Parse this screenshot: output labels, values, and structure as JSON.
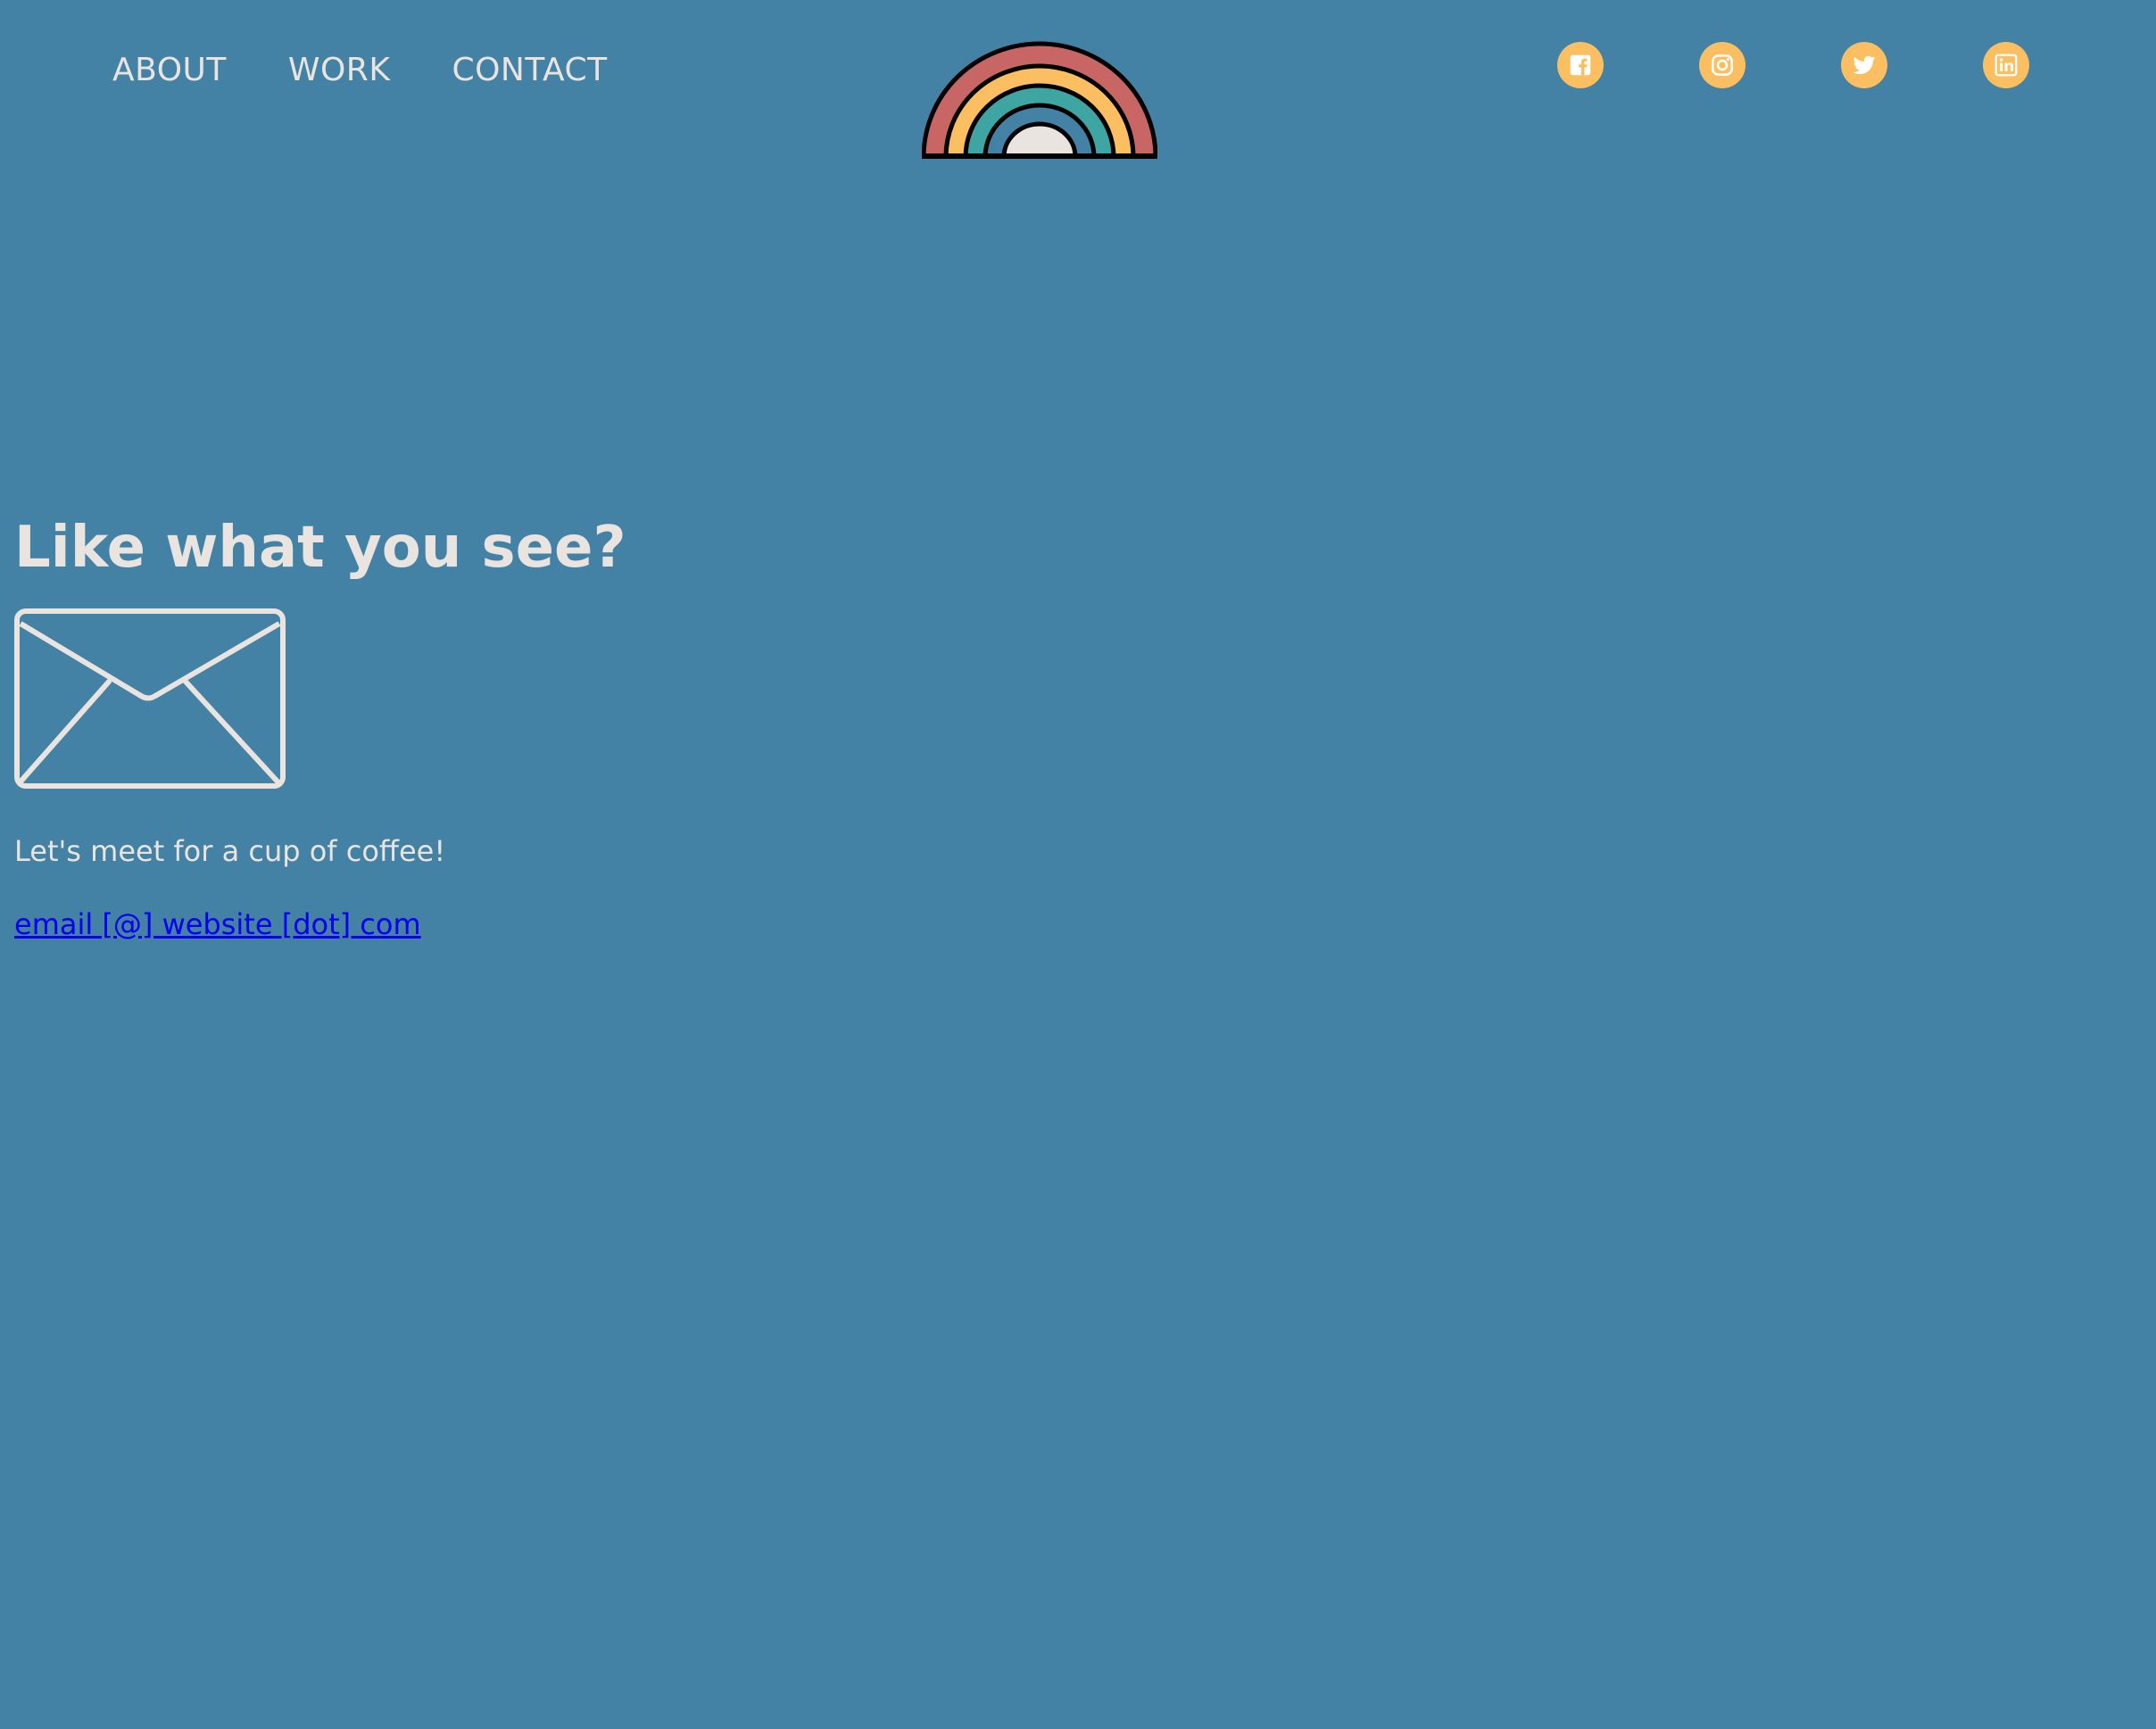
{
  "nav": {
    "links": [
      {
        "label": "ABOUT"
      },
      {
        "label": "WORK"
      },
      {
        "label": "CONTACT"
      }
    ]
  },
  "logo": {
    "icon": "rainbow-logo-icon"
  },
  "social": {
    "items": [
      {
        "icon": "facebook-icon"
      },
      {
        "icon": "instagram-icon"
      },
      {
        "icon": "twitter-icon"
      },
      {
        "icon": "linkedin-icon"
      }
    ]
  },
  "contact": {
    "headline": "Like what you see?",
    "icon": "envelope-icon",
    "tagline": "Let's meet for a cup of coffee!",
    "email_link": "email [@] website [dot] com"
  },
  "colors": {
    "background": "#4381a5",
    "text": "#e9e4df",
    "accent": "#fbbe60",
    "link": "#0000ee",
    "rainbow": [
      "#c86565",
      "#fbbe60",
      "#3ea5a3",
      "#4381a5",
      "#e9e4df"
    ]
  }
}
